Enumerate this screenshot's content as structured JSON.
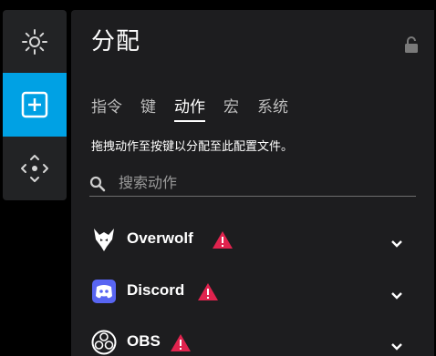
{
  "sidebar": {
    "items": [
      {
        "icon": "brightness-icon"
      },
      {
        "icon": "add-square-icon",
        "active": true
      },
      {
        "icon": "move-icon"
      }
    ],
    "accent": "#00a1e4"
  },
  "panel": {
    "title": "分配",
    "tabs": [
      {
        "label": "指令"
      },
      {
        "label": "键"
      },
      {
        "label": "动作",
        "active": true
      },
      {
        "label": "宏"
      },
      {
        "label": "系统"
      }
    ],
    "hint": "拖拽动作至按键以分配至此配置文件。",
    "search": {
      "placeholder": "搜索动作",
      "value": ""
    },
    "integrations": [
      {
        "name": "Overwolf",
        "icon": "overwolf-icon",
        "warning": true
      },
      {
        "name": "Discord",
        "icon": "discord-icon",
        "warning": true
      },
      {
        "name": "OBS",
        "icon": "obs-icon",
        "warning": true
      }
    ],
    "warning_color": "#e0234e"
  }
}
